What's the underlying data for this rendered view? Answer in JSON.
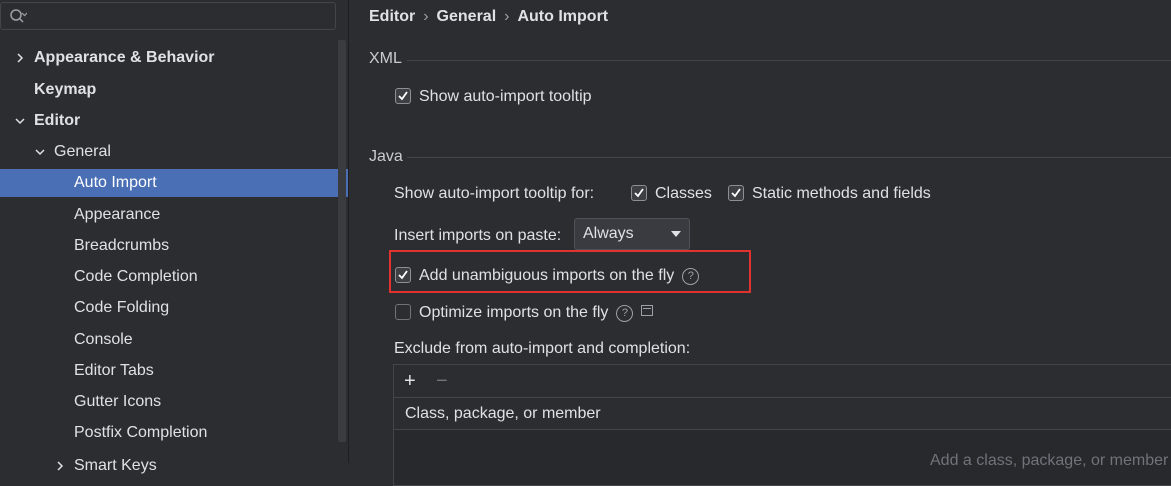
{
  "search": {
    "placeholder": ""
  },
  "sidebar": {
    "items": [
      {
        "label": "Appearance & Behavior",
        "expanded": false
      },
      {
        "label": "Keymap"
      },
      {
        "label": "Editor",
        "expanded": true
      },
      {
        "label": "General",
        "expanded": true
      },
      {
        "label": "Auto Import",
        "selected": true
      },
      {
        "label": "Appearance"
      },
      {
        "label": "Breadcrumbs"
      },
      {
        "label": "Code Completion"
      },
      {
        "label": "Code Folding"
      },
      {
        "label": "Console"
      },
      {
        "label": "Editor Tabs"
      },
      {
        "label": "Gutter Icons"
      },
      {
        "label": "Postfix Completion"
      },
      {
        "label": "Smart Keys"
      }
    ]
  },
  "breadcrumb": {
    "items": [
      "Editor",
      "General",
      "Auto Import"
    ],
    "separator": "›"
  },
  "xml": {
    "title": "XML",
    "show_tooltip": {
      "label": "Show auto-import tooltip",
      "checked": true
    }
  },
  "java": {
    "title": "Java",
    "tooltip_for_label": "Show auto-import tooltip for:",
    "classes": {
      "label": "Classes",
      "checked": true
    },
    "static_methods": {
      "label": "Static methods and fields",
      "checked": true
    },
    "insert_on_paste_label": "Insert imports on paste:",
    "insert_on_paste_value": "Always",
    "add_unambiguous": {
      "label": "Add unambiguous imports on the fly",
      "checked": true
    },
    "optimize": {
      "label": "Optimize imports on the fly",
      "checked": false
    },
    "exclude_label": "Exclude from auto-import and completion:",
    "table_header": "Class, package, or member",
    "add_symbol": "+",
    "remove_symbol": "−",
    "empty_hint": "Add a class, package, or member"
  },
  "colors": {
    "background": "#2b2d30",
    "selection": "#4a6fb5",
    "highlight_border": "#e0322f"
  },
  "icons": [
    "search-icon",
    "chevron-right-icon",
    "chevron-down-icon",
    "help-icon",
    "check-icon",
    "plus-icon",
    "minus-icon"
  ]
}
